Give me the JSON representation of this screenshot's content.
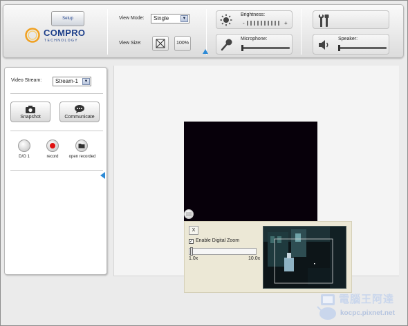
{
  "brand": {
    "name": "COMPRO",
    "tagline": "TECHNOLOGY"
  },
  "toolbar": {
    "view_mode_label": "View Mode:",
    "view_mode_value": "Single",
    "view_size_label": "View Size:",
    "zoom_100_label": "100%",
    "brightness_label": "Brightness:",
    "brightness_minus": "-",
    "brightness_plus": "+",
    "brightness_level": 0.1,
    "microphone_label": "Microphone:",
    "microphone_level": 0.0,
    "setup_label": "Setup",
    "speaker_label": "Speaker:",
    "speaker_level": 0.0
  },
  "left_panel": {
    "video_stream_label": "Video Stream:",
    "video_stream_value": "Stream-1",
    "snapshot_label": "Snapshot",
    "communicate_label": "Communicate",
    "do1_label": "D/O 1",
    "record_label": "record",
    "open_recorded_label": "open recorded"
  },
  "zoom_panel": {
    "close_label": "X",
    "checkbox_checked": true,
    "checkbox_mark": "✓",
    "enable_label": "Enable Digital Zoom",
    "min_label": "1.0x",
    "max_label": "10.0x",
    "zoom_level": 0.0
  },
  "watermark": {
    "title": "電腦王阿達",
    "url": "kocpc.pixnet.net"
  },
  "colors": {
    "accent_blue": "#2d8ad6",
    "brand_blue": "#1d3f8a",
    "logo_orange": "#f0a020",
    "video_bg": "#07000a"
  }
}
